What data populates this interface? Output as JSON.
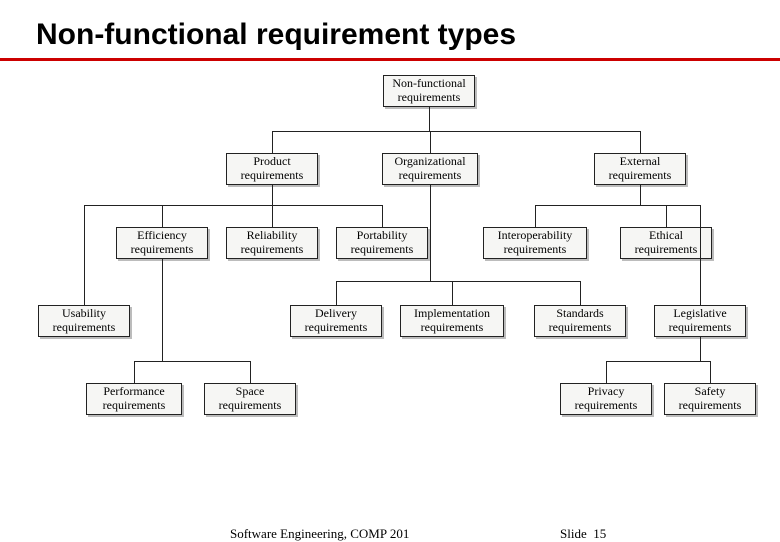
{
  "title": "Non-functional requirement types",
  "boxes": {
    "root": "Non-functional\nrequirements",
    "product": "Product\nrequirements",
    "organizational": "Organizational\nrequirements",
    "external": "External\nrequirements",
    "efficiency": "Efficiency\nrequirements",
    "reliability": "Reliability\nrequirements",
    "portability": "Portability\nrequirements",
    "interoperability": "Interoperability\nrequirements",
    "ethical": "Ethical\nrequirements",
    "usability": "Usability\nrequirements",
    "delivery": "Delivery\nrequirements",
    "implementation": "Implementation\nrequirements",
    "standards": "Standards\nrequirements",
    "legislative": "Legislative\nrequirements",
    "performance": "Performance\nrequirements",
    "space": "Space\nrequirements",
    "privacy": "Privacy\nrequirements",
    "safety": "Safety\nrequirements"
  },
  "footer": {
    "left": "Software Engineering, COMP 201",
    "right_label": "Slide",
    "right_num": "15"
  }
}
